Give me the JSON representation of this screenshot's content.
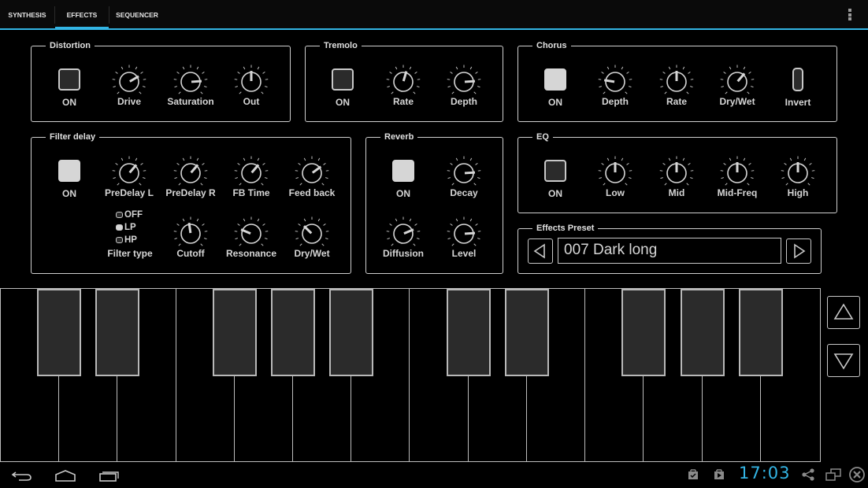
{
  "tabs": [
    {
      "label": "SYNTHESIS",
      "active": false
    },
    {
      "label": "EFFECTS",
      "active": true
    },
    {
      "label": "SEQUENCER",
      "active": false
    }
  ],
  "colors": {
    "accent": "#33b5e5",
    "toggle_on": "#d6d6d6",
    "toggle_off": "#2b2b2b",
    "black_key": "#2b2b2b"
  },
  "distortion": {
    "title": "Distortion",
    "on_label": "ON",
    "on": false,
    "knobs": [
      {
        "label": "Drive",
        "value": 0.72
      },
      {
        "label": "Saturation",
        "value": 0.82
      },
      {
        "label": "Out",
        "value": 0.5
      }
    ]
  },
  "tremolo": {
    "title": "Tremolo",
    "on_label": "ON",
    "on": false,
    "knobs": [
      {
        "label": "Rate",
        "value": 0.56
      },
      {
        "label": "Depth",
        "value": 0.82
      }
    ]
  },
  "chorus": {
    "title": "Chorus",
    "on_label": "ON",
    "on": true,
    "knobs": [
      {
        "label": "Depth",
        "value": 0.2
      },
      {
        "label": "Rate",
        "value": 0.5
      },
      {
        "label": "Dry/Wet",
        "value": 0.65
      }
    ],
    "invert_label": "Invert",
    "invert": false
  },
  "filter_delay": {
    "title": "Filter delay",
    "on_label": "ON",
    "on": true,
    "knobs_top": [
      {
        "label": "PreDelay L",
        "value": 0.65
      },
      {
        "label": "PreDelay R",
        "value": 0.65
      },
      {
        "label": "FB Time",
        "value": 0.65
      },
      {
        "label": "Feed back",
        "value": 0.7
      }
    ],
    "filter_type": {
      "label": "Filter type",
      "options": [
        "OFF",
        "LP",
        "HP"
      ],
      "selected": "LP"
    },
    "knobs_bottom": [
      {
        "label": "Cutoff",
        "value": 0.47
      },
      {
        "label": "Resonance",
        "value": 0.25
      },
      {
        "label": "Dry/Wet",
        "value": 0.33
      }
    ]
  },
  "reverb": {
    "title": "Reverb",
    "on_label": "ON",
    "on": true,
    "knobs": [
      {
        "label": "Decay",
        "value": 0.82
      },
      {
        "label": "Diffusion",
        "value": 0.75
      },
      {
        "label": "Level",
        "value": 0.82
      }
    ]
  },
  "eq": {
    "title": "EQ",
    "on_label": "ON",
    "on": false,
    "knobs": [
      {
        "label": "Low",
        "value": 0.5
      },
      {
        "label": "Mid",
        "value": 0.5
      },
      {
        "label": "Mid-Freq",
        "value": 0.5
      },
      {
        "label": "High",
        "value": 0.5
      }
    ]
  },
  "preset": {
    "title": "Effects Preset",
    "value": "007 Dark long",
    "prev_icon": "triangle-left-icon",
    "next_icon": "triangle-right-icon"
  },
  "keyboard": {
    "white_keys": 14,
    "octave_up_icon": "triangle-up-icon",
    "octave_down_icon": "triangle-down-icon"
  },
  "navbar": {
    "clock": "17:03",
    "icons": [
      "back-icon",
      "home-icon",
      "recent-apps-icon",
      "task-check-icon",
      "play-store-icon",
      "share-icon",
      "screen-icon",
      "close-icon"
    ]
  }
}
